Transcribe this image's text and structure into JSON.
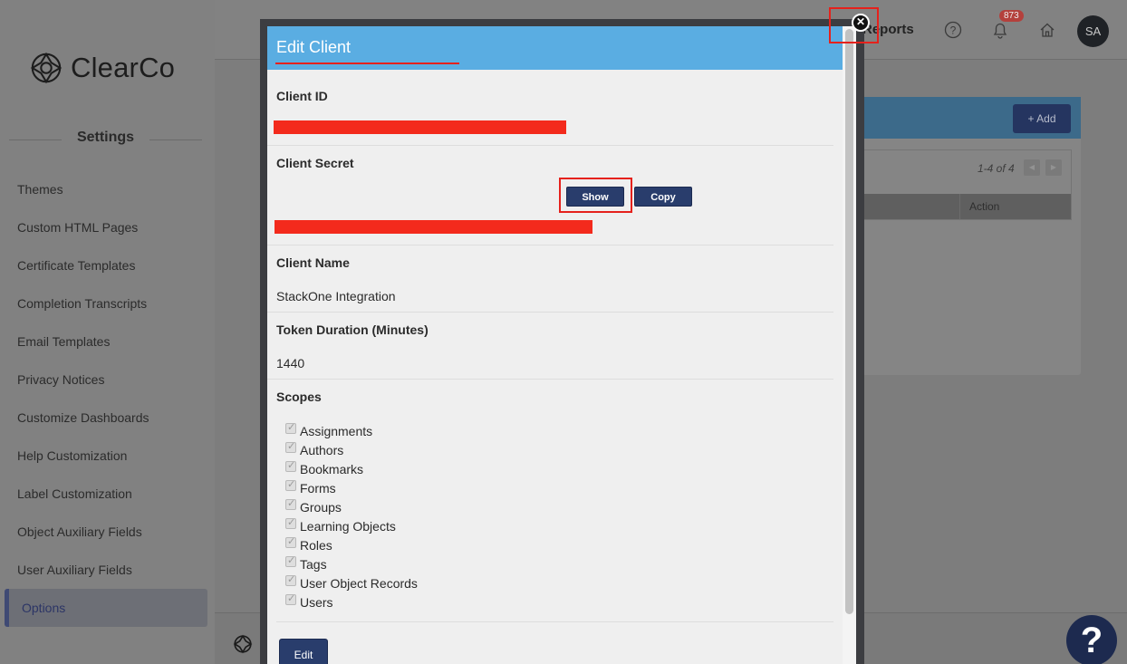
{
  "brand": {
    "name": "ClearCo",
    "logo_icon": "clearco-logo-icon"
  },
  "sidebar": {
    "heading": "Settings",
    "items": [
      {
        "label": "Themes"
      },
      {
        "label": "Custom HTML Pages"
      },
      {
        "label": "Certificate Templates"
      },
      {
        "label": "Completion Transcripts"
      },
      {
        "label": "Email Templates"
      },
      {
        "label": "Privacy Notices"
      },
      {
        "label": "Customize Dashboards"
      },
      {
        "label": "Help Customization"
      },
      {
        "label": "Label Customization"
      },
      {
        "label": "Object Auxiliary Fields"
      },
      {
        "label": "User Auxiliary Fields"
      },
      {
        "label": "Options",
        "active": true
      }
    ]
  },
  "topbar": {
    "reports_label": "Reports",
    "notification_count": "873",
    "avatar_initials": "SA",
    "icons": [
      "help-circle-icon",
      "bell-icon",
      "home-icon"
    ]
  },
  "panel": {
    "add_label": "+ Add",
    "pager_text": "1-4 of 4",
    "action_header": "Action"
  },
  "modal": {
    "title": "Edit Client",
    "client_id_label": "Client ID",
    "client_secret_label": "Client Secret",
    "show_label": "Show",
    "copy_label": "Copy",
    "client_name_label": "Client Name",
    "client_name_value": "StackOne Integration",
    "token_duration_label": "Token Duration (Minutes)",
    "token_duration_value": "1440",
    "scopes_label": "Scopes",
    "scopes": [
      "Assignments",
      "Authors",
      "Bookmarks",
      "Forms",
      "Groups",
      "Learning Objects",
      "Roles",
      "Tags",
      "User Object Records",
      "Users"
    ],
    "edit_label": "Edit"
  },
  "help_fab_label": "?",
  "colors": {
    "modal_header": "#5aade2",
    "primary_button": "#293d6c",
    "highlight": "#e5211c"
  }
}
